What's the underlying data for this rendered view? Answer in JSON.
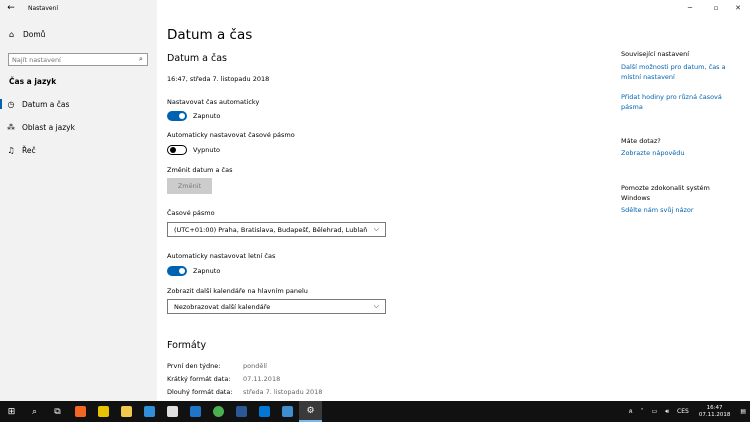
{
  "window": {
    "title": "Nastavení"
  },
  "sidebar": {
    "home_label": "Domů",
    "search_placeholder": "Najít nastavení",
    "section_title": "Čas a jazyk",
    "items": [
      {
        "label": "Datum a čas",
        "icon": "clock-icon",
        "active": true
      },
      {
        "label": "Oblast a jazyk",
        "icon": "region-language-icon",
        "active": false
      },
      {
        "label": "Řeč",
        "icon": "microphone-icon",
        "active": false
      }
    ]
  },
  "main": {
    "page_title": "Datum a čas",
    "section_title": "Datum a čas",
    "current_datetime": "16:47, středa 7. listopadu 2018",
    "auto_time": {
      "label": "Nastavovat čas automaticky",
      "state_text": "Zapnuto",
      "on": true
    },
    "auto_timezone": {
      "label": "Automaticky nastavovat časové pásmo",
      "state_text": "Vypnuto",
      "on": false
    },
    "change_datetime": {
      "label": "Změnit datum a čas",
      "button": "Změnit"
    },
    "timezone": {
      "label": "Časové pásmo",
      "value": "(UTC+01:00) Praha, Bratislava, Budapešť, Bělehrad, Lublaň"
    },
    "dst": {
      "label": "Automaticky nastavovat letní čas",
      "state_text": "Zapnuto",
      "on": true
    },
    "extra_calendars": {
      "label": "Zobrazit další kalendáře na hlavním panelu",
      "value": "Nezobrazovat další kalendáře"
    },
    "formats": {
      "title": "Formáty",
      "rows": [
        {
          "key": "První den týdne:",
          "value": "pondělí"
        },
        {
          "key": "Krátký formát data:",
          "value": "07.11.2018"
        },
        {
          "key": "Dlouhý formát data:",
          "value": "středa 7. listopadu 2018"
        }
      ]
    }
  },
  "right": {
    "related_title": "Související nastavení",
    "related_link1": "Další možnosti pro datum, čas a místní nastavení",
    "related_link2": "Přidat hodiny pro různá časová pásma",
    "question_title": "Máte dotaz?",
    "question_link": "Zobrazte nápovědu",
    "improve_title": "Pomozte zdokonalit systém Windows",
    "improve_link": "Sdělte nám svůj názor"
  },
  "taskbar": {
    "tray_lang": "CES",
    "tray_ime": "ጸ",
    "time": "16:47",
    "date": "07.11.2018",
    "apps": [
      {
        "icon": "avast-icon",
        "color": "#f26722"
      },
      {
        "icon": "media-player-icon",
        "color": "#e6c200"
      },
      {
        "icon": "explorer-icon",
        "color": "#f2c94c"
      },
      {
        "icon": "photos-icon",
        "color": "#2f8fd8"
      },
      {
        "icon": "calculator-icon",
        "color": "#e0e0e0"
      },
      {
        "icon": "outlook-icon",
        "color": "#1f75c9"
      },
      {
        "icon": "chrome-icon",
        "color": "#4caf50"
      },
      {
        "icon": "word-icon",
        "color": "#2b5797"
      },
      {
        "icon": "mail-icon",
        "color": "#0078d7"
      },
      {
        "icon": "app-icon",
        "color": "#3e8ed0"
      }
    ]
  }
}
